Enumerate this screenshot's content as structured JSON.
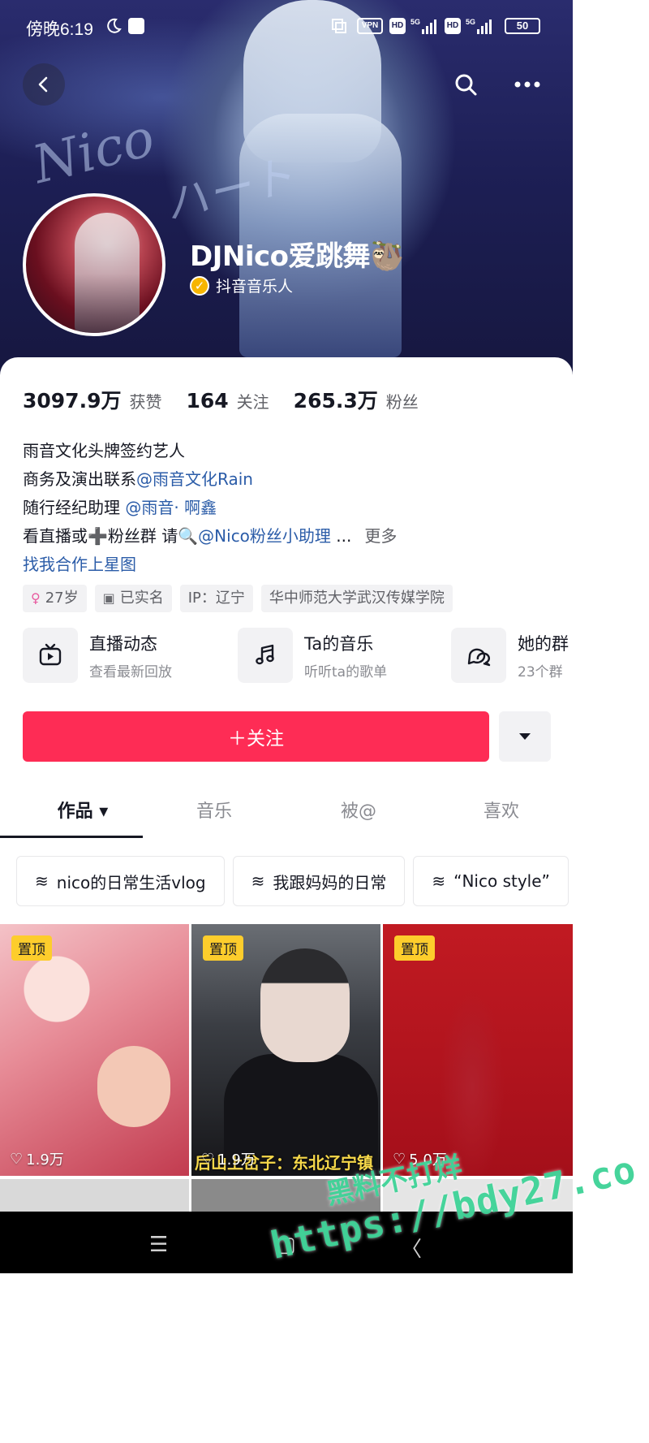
{
  "status_bar": {
    "time": "傍晚6:19",
    "vpn": "VPN",
    "hd": "HD",
    "net": "5G",
    "battery": "50"
  },
  "banner": {
    "script_text_1": "Nico",
    "script_text_2": "ハート"
  },
  "profile": {
    "name": "DJNico爱跳舞🦥",
    "verify_label": "抖音音乐人"
  },
  "stats": [
    {
      "value": "3097.9万",
      "label": "获赞"
    },
    {
      "value": "164",
      "label": "关注"
    },
    {
      "value": "265.3万",
      "label": "粉丝"
    }
  ],
  "bio": {
    "line1": "雨音文化头牌签约艺人",
    "line2_text": "商务及演出联系",
    "line2_mention": "@雨音文化Rain",
    "line3_text": "随行经纪助理 ",
    "line3_mention": "@雨音· 啊鑫",
    "line4_text": "看直播或➕粉丝群 请🔍",
    "line4_mention": "@Nico粉丝小助理",
    "line4_ellipsis": " ...",
    "more": "更多",
    "link": "找我合作上星图"
  },
  "tags": [
    {
      "icon": "female-icon",
      "glyph": "♀",
      "text": "27岁"
    },
    {
      "icon": "id-card-icon",
      "glyph": "▣",
      "text": "已实名"
    },
    {
      "icon": "",
      "glyph": "",
      "text": "IP：辽宁"
    },
    {
      "icon": "",
      "glyph": "",
      "text": "华中师范大学武汉传媒学院"
    }
  ],
  "features": [
    {
      "title": "直播动态",
      "sub": "查看最新回放",
      "icon": "live-tv-icon"
    },
    {
      "title": "Ta的音乐",
      "sub": "听听ta的歌单",
      "icon": "music-note-icon"
    },
    {
      "title": "她的群",
      "sub": "23个群",
      "icon": "group-chat-icon"
    }
  ],
  "follow_button": "＋关注",
  "tabs": [
    {
      "label": "作品 ▾"
    },
    {
      "label": "音乐"
    },
    {
      "label": "被@"
    },
    {
      "label": "喜欢"
    }
  ],
  "collections": [
    {
      "label": "nico的日常生活vlog"
    },
    {
      "label": "我跟妈妈的日常"
    },
    {
      "label": "“Nico style”"
    }
  ],
  "videos": [
    {
      "pin": "置顶",
      "likes": "1.9万"
    },
    {
      "pin": "置顶",
      "likes": "1.9万",
      "caption": "后山上岔子：东北辽宁镇"
    },
    {
      "pin": "置顶",
      "likes": "5.0万"
    }
  ],
  "navbar": {
    "menu": "☰",
    "home": "▢",
    "back": "〈"
  },
  "watermark": {
    "line1": "黑料不打烊",
    "line2": "https://bdy27.co"
  },
  "colors": {
    "follow": "#fe2c55",
    "mention": "#2b5ca8",
    "pin": "#fdcd2c"
  }
}
